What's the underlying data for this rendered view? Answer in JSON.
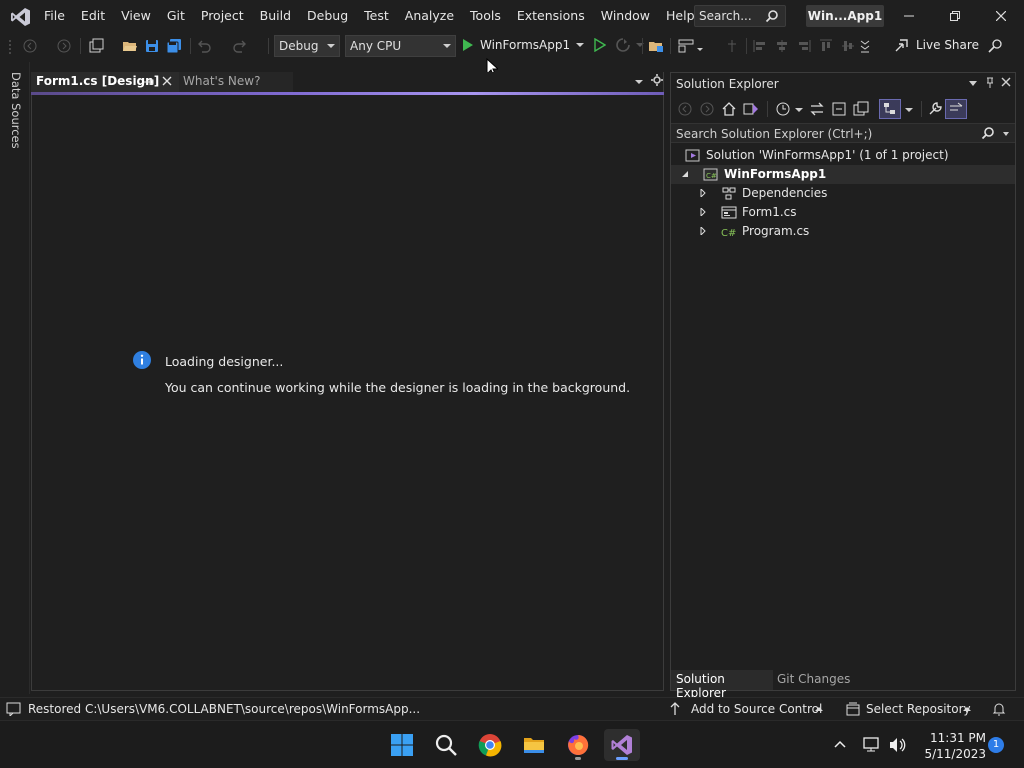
{
  "menu": [
    "File",
    "Edit",
    "View",
    "Git",
    "Project",
    "Build",
    "Debug",
    "Test",
    "Analyze",
    "Tools",
    "Extensions",
    "Window",
    "Help"
  ],
  "search": {
    "label": "Search..."
  },
  "solution_badge": "Win...App1",
  "toolbar": {
    "config": "Debug",
    "platform": "Any CPU",
    "run_target": "WinFormsApp1",
    "live_share": "Live Share"
  },
  "left_rail": {
    "data_sources": "Data Sources"
  },
  "tabs": {
    "active": "Form1.cs [Design]",
    "inactive": "What's New?"
  },
  "designer": {
    "title": "Loading designer...",
    "message": "You can continue working while the designer is loading in the background."
  },
  "solution_explorer": {
    "title": "Solution Explorer",
    "search_placeholder": "Search Solution Explorer (Ctrl+;)",
    "tree": {
      "solution": "Solution 'WinFormsApp1' (1 of 1 project)",
      "project": "WinFormsApp1",
      "items": [
        "Dependencies",
        "Form1.cs",
        "Program.cs"
      ]
    },
    "bottom_tabs": [
      "Solution Explorer",
      "Git Changes"
    ]
  },
  "statusbar": {
    "message": "Restored C:\\Users\\VM6.COLLABNET\\source\\repos\\WinFormsApp...",
    "add_to_source": "Add to Source Control",
    "select_repo": "Select Repository"
  },
  "taskbar": {
    "time": "11:31 PM",
    "date": "5/11/2023",
    "notifications": "1"
  },
  "colors": {
    "accent": "#7f6ad1",
    "run_green": "#3fb950",
    "info_blue": "#2f7fe0",
    "csharp_green": "#86c157"
  }
}
